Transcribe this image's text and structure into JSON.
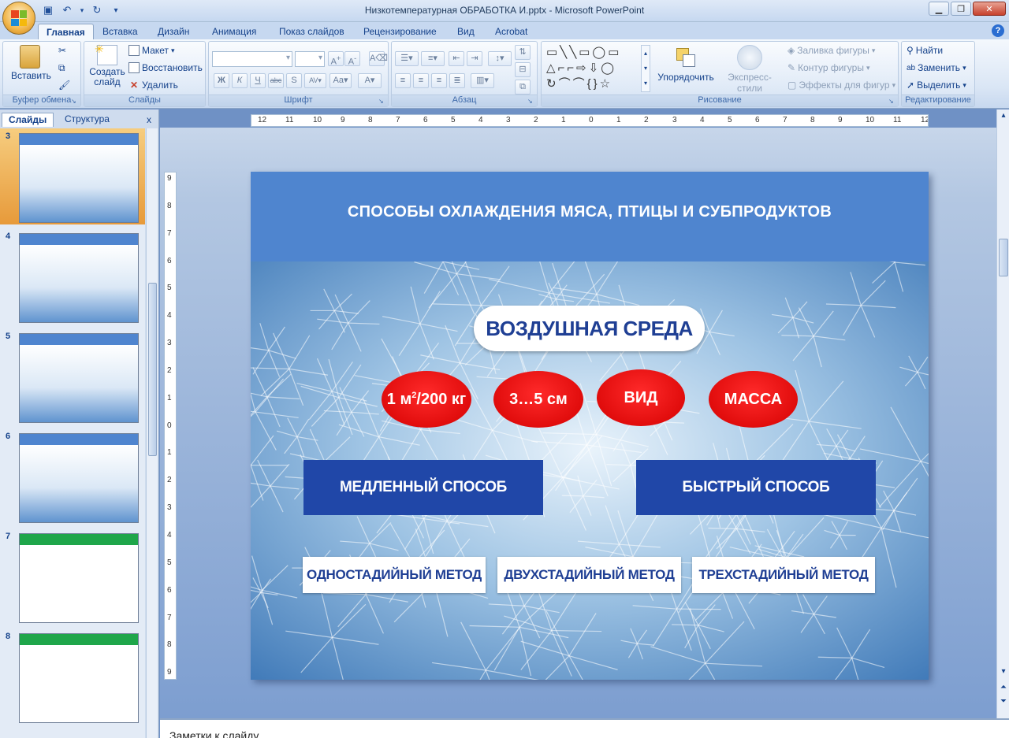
{
  "window": {
    "title": "Низкотемпературная ОБРАБОТКА И.pptx - Microsoft PowerPoint"
  },
  "ribbon_tabs": [
    "Главная",
    "Вставка",
    "Дизайн",
    "Анимация",
    "Показ слайдов",
    "Рецензирование",
    "Вид",
    "Acrobat"
  ],
  "ribbon": {
    "clipboard": {
      "label": "Буфер обмена",
      "paste": "Вставить"
    },
    "slides": {
      "label": "Слайды",
      "new_slide": "Создать слайд",
      "layout": "Макет",
      "reset": "Восстановить",
      "delete": "Удалить"
    },
    "font": {
      "label": "Шрифт"
    },
    "paragraph": {
      "label": "Абзац"
    },
    "drawing": {
      "label": "Рисование",
      "arrange": "Упорядочить",
      "quick_styles": "Экспресс-стили",
      "shape_fill": "Заливка фигуры",
      "shape_outline": "Контур фигуры",
      "shape_effects": "Эффекты для фигур"
    },
    "editing": {
      "label": "Редактирование",
      "find": "Найти",
      "replace": "Заменить",
      "select": "Выделить"
    }
  },
  "left_pane": {
    "tab_slides": "Слайды",
    "tab_outline": "Структура",
    "close": "x",
    "thumbnails": [
      {
        "num": "3",
        "selected": true,
        "color": "#4f85cf"
      },
      {
        "num": "4",
        "selected": false,
        "color": "#4f85cf"
      },
      {
        "num": "5",
        "selected": false,
        "color": "#4f85cf"
      },
      {
        "num": "6",
        "selected": false,
        "color": "#4f85cf"
      },
      {
        "num": "7",
        "selected": false,
        "color": "#1fa64a"
      },
      {
        "num": "8",
        "selected": false,
        "color": "#1fa64a"
      }
    ]
  },
  "hruler_labels": [
    "12",
    "11",
    "10",
    "9",
    "8",
    "7",
    "6",
    "5",
    "4",
    "3",
    "2",
    "1",
    "0",
    "1",
    "2",
    "3",
    "4",
    "5",
    "6",
    "7",
    "8",
    "9",
    "10",
    "11",
    "12"
  ],
  "vruler_labels": [
    "9",
    "8",
    "7",
    "6",
    "5",
    "4",
    "3",
    "2",
    "1",
    "0",
    "1",
    "2",
    "3",
    "4",
    "5",
    "6",
    "7",
    "8",
    "9"
  ],
  "slide": {
    "title": "СПОСОБЫ ОХЛАЖДЕНИЯ МЯСА, ПТИЦЫ И СУБПРОДУКТОВ",
    "pill": "ВОЗДУШНАЯ СРЕДА",
    "oval_1_main": "1 м",
    "oval_1_sup": "2",
    "oval_1_tail": "/200 кг",
    "oval_2": "3…5 см",
    "oval_3": "ВИД",
    "oval_4": "МАССА",
    "method_slow": "МЕДЛЕННЫЙ СПОСОБ",
    "method_fast": "БЫСТРЫЙ СПОСОБ",
    "stage_1": "ОДНОСТАДИЙНЫЙ МЕТОД",
    "stage_2": "ДВУХСТАДИЙНЫЙ МЕТОД",
    "stage_3": "ТРЕХСТАДИЙНЫЙ МЕТОД"
  },
  "notes": {
    "text": "Заметки к слайду"
  },
  "colors": {
    "header_blue": "#4f85cf",
    "oval_red": "#e00000",
    "box_blue": "#2047a8",
    "text_dark_blue": "#1f3f94"
  }
}
